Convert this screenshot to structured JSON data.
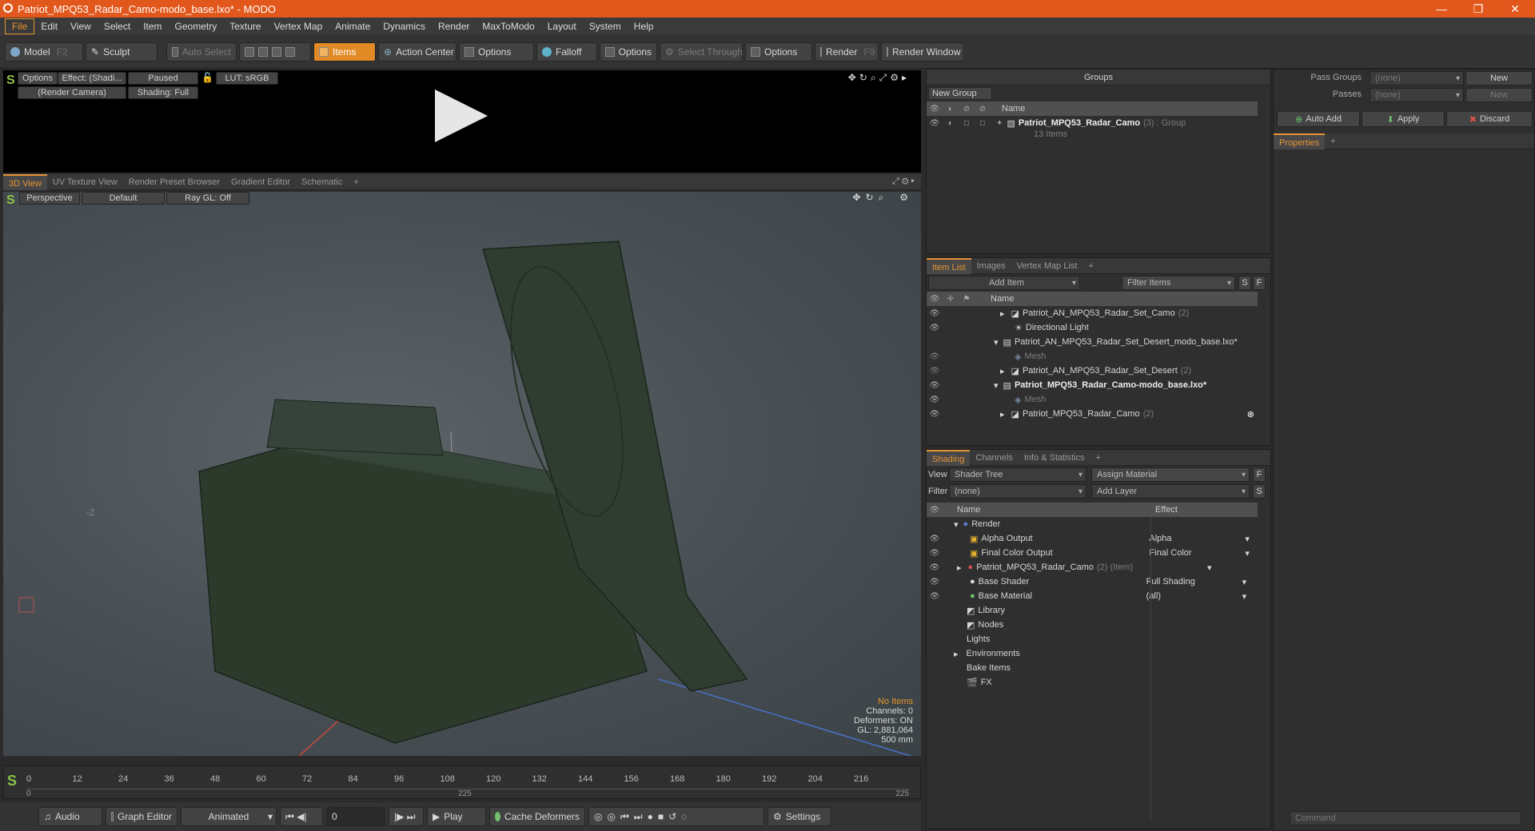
{
  "window": {
    "title": "Patriot_MPQ53_Radar_Camo-modo_base.lxo* - MODO"
  },
  "menu": [
    "File",
    "Edit",
    "View",
    "Select",
    "Item",
    "Geometry",
    "Texture",
    "Vertex Map",
    "Animate",
    "Dynamics",
    "Render",
    "MaxToModo",
    "Layout",
    "System",
    "Help"
  ],
  "toolbar": {
    "model": "Model",
    "model_key": "F2",
    "sculpt": "Sculpt",
    "auto_select": "Auto Select",
    "items": "Items",
    "action_center": "Action Center",
    "options1": "Options",
    "falloff": "Falloff",
    "options2": "Options",
    "select_through": "Select Through",
    "options3": "Options",
    "render": "Render",
    "render_key": "F9",
    "render_window": "Render Window"
  },
  "preview": {
    "options": "Options",
    "effect": "Effect: (Shadi...",
    "paused": "Paused",
    "lut": "LUT: sRGB",
    "camera": "(Render Camera)",
    "shading": "Shading: Full"
  },
  "view_tabs": [
    "3D View",
    "UV Texture View",
    "Render Preset Browser",
    "Gradient Editor",
    "Schematic"
  ],
  "viewport": {
    "perspective": "Perspective",
    "default": "Default",
    "raygl": "Ray GL: Off",
    "axis_label": "-Z",
    "info": {
      "no_items": "No Items",
      "channels": "Channels: 0",
      "deformers": "Deformers: ON",
      "gl": "GL: 2,881,064",
      "scale": "500 mm"
    }
  },
  "timeline": {
    "ticks": [
      "0",
      "12",
      "24",
      "36",
      "48",
      "60",
      "72",
      "84",
      "96",
      "108",
      "120",
      "132",
      "144",
      "156",
      "168",
      "180",
      "192",
      "204",
      "216"
    ],
    "sub_start": "0",
    "sub_mid": "225",
    "sub_end": "225"
  },
  "bottombar": {
    "audio": "Audio",
    "graph_editor": "Graph Editor",
    "animated": "Animated",
    "frame": "0",
    "play": "Play",
    "cache_deformers": "Cache Deformers",
    "settings": "Settings"
  },
  "groups": {
    "title": "Groups",
    "new_group": "New Group",
    "col_name": "Name",
    "item_name": "Patriot_MPQ53_Radar_Camo",
    "item_count": "(3)",
    "item_type": ": Group",
    "item_sub": "13 Items"
  },
  "pass": {
    "pass_groups": "Pass Groups",
    "passes": "Passes",
    "none": "(none)",
    "new": "New",
    "auto_add": "Auto Add",
    "apply": "Apply",
    "discard": "Discard",
    "properties_tab": "Properties"
  },
  "itemlist": {
    "tabs": [
      "Item List",
      "Images",
      "Vertex Map List"
    ],
    "add_item": "Add Item",
    "filter": "Filter Items",
    "s": "S",
    "f": "F",
    "col_name": "Name",
    "rows": [
      {
        "label": "Patriot_AN_MPQ53_Radar_Set_Camo",
        "count": "(2)"
      },
      {
        "label": "Directional Light",
        "count": ""
      },
      {
        "label": "Patriot_AN_MPQ53_Radar_Set_Desert_modo_base.lxo*",
        "count": ""
      },
      {
        "label": "Mesh",
        "count": ""
      },
      {
        "label": "Patriot_AN_MPQ53_Radar_Set_Desert",
        "count": "(2)"
      },
      {
        "label": "Patriot_MPQ53_Radar_Camo-modo_base.lxo*",
        "count": ""
      },
      {
        "label": "Mesh",
        "count": ""
      },
      {
        "label": "Patriot_MPQ53_Radar_Camo",
        "count": "(2)"
      }
    ]
  },
  "shading": {
    "tabs": [
      "Shading",
      "Channels",
      "Info & Statistics"
    ],
    "view_label": "View",
    "view_value": "Shader Tree",
    "assign": "Assign Material",
    "filter_label": "Filter",
    "filter_value": "(none)",
    "add_layer": "Add Layer",
    "f": "F",
    "s": "S",
    "col_name": "Name",
    "col_effect": "Effect",
    "rows": [
      {
        "name": "Render",
        "effect": ""
      },
      {
        "name": "Alpha Output",
        "effect": "Alpha"
      },
      {
        "name": "Final Color Output",
        "effect": "Final Color"
      },
      {
        "name": "Patriot_MPQ53_Radar_Camo",
        "extra": "(2) (Item)",
        "effect": ""
      },
      {
        "name": "Base Shader",
        "effect": "Full Shading"
      },
      {
        "name": "Base Material",
        "effect": "(all)"
      },
      {
        "name": "Library",
        "effect": ""
      },
      {
        "name": "Nodes",
        "effect": ""
      },
      {
        "name": "Lights",
        "effect": ""
      },
      {
        "name": "Environments",
        "effect": ""
      },
      {
        "name": "Bake Items",
        "effect": ""
      },
      {
        "name": "FX",
        "effect": ""
      }
    ]
  },
  "command": {
    "placeholder": "Command"
  },
  "colors": {
    "accent": "#e6952d",
    "title": "#e2571b",
    "mesh": "#2c3a2c"
  }
}
